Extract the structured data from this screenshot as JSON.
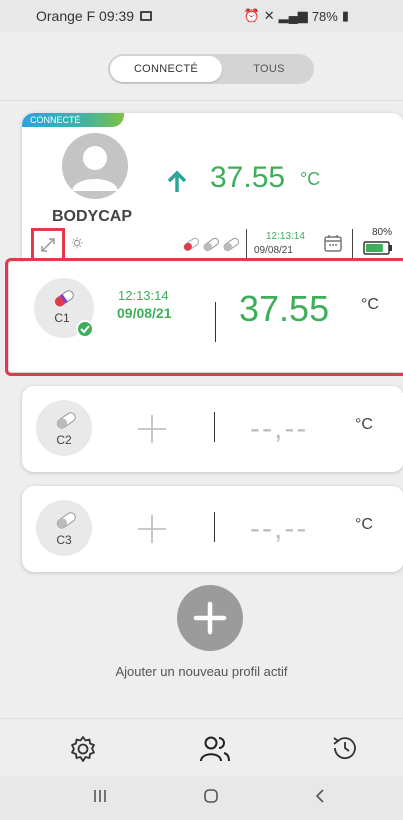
{
  "status_bar": {
    "carrier_time": "Orange F 09:39",
    "battery": "78%"
  },
  "toggle": {
    "connected_label": "CONNECTÉ",
    "all_label": "TOUS"
  },
  "main_card": {
    "badge": "CONNECTÉ",
    "device_name": "BODYCAP",
    "temperature": "37.55",
    "unit": "°C",
    "trend": "up",
    "time": "12:13:14",
    "date": "09/08/21",
    "battery_percent": "80%",
    "battery_level": 0.8
  },
  "slots": [
    {
      "label": "C1",
      "time": "12:13:14",
      "date": "09/08/21",
      "temperature": "37.55",
      "unit": "°C",
      "connected": true
    },
    {
      "label": "C2",
      "temperature": "--,--",
      "unit": "°C"
    },
    {
      "label": "C3",
      "temperature": "--,--",
      "unit": "°C"
    }
  ],
  "add_profile_label": "Ajouter un nouveau profil actif",
  "colors": {
    "accent_green": "#3fae5a",
    "highlight_red": "#e23a4c",
    "badge_blue": "#2aa3de"
  },
  "icons": {
    "nav": [
      "settings-icon",
      "users-icon",
      "history-icon"
    ],
    "system": [
      "recent-apps-icon",
      "home-icon",
      "back-icon"
    ]
  }
}
